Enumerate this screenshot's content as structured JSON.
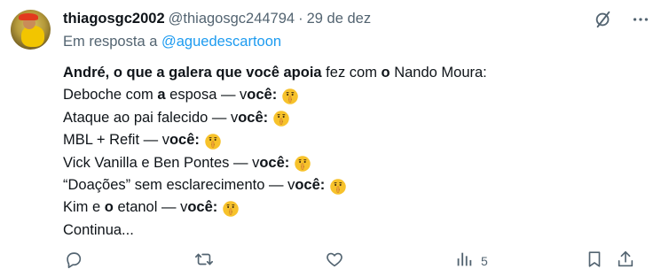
{
  "tweet": {
    "display_name": "thiagosgc2002",
    "handle": "@thiagosgc244794",
    "separator": "·",
    "date": "29 de dez",
    "reply_prefix": "Em resposta a",
    "reply_to": "@aguedescartoon",
    "lines": [
      {
        "segments": [
          {
            "text": "André, o que a galera que você apoia",
            "bold": true
          },
          {
            "text": " fez com ",
            "bold": false
          },
          {
            "text": "o",
            "bold": true
          },
          {
            "text": " Nando Moura:",
            "bold": false
          }
        ],
        "emoji": false
      },
      {
        "segments": [
          {
            "text": "Deboche com ",
            "bold": false
          },
          {
            "text": "a",
            "bold": true
          },
          {
            "text": " esposa — v",
            "bold": false
          },
          {
            "text": "ocê:",
            "bold": true
          }
        ],
        "emoji": true
      },
      {
        "segments": [
          {
            "text": "Ataque ao pai falecido — v",
            "bold": false
          },
          {
            "text": "ocê:",
            "bold": true
          }
        ],
        "emoji": true
      },
      {
        "segments": [
          {
            "text": "MBL + Refit — v",
            "bold": false
          },
          {
            "text": "ocê:",
            "bold": true
          }
        ],
        "emoji": true
      },
      {
        "segments": [
          {
            "text": "Vick Vanilla e Ben Pontes — v",
            "bold": false
          },
          {
            "text": "ocê:",
            "bold": true
          }
        ],
        "emoji": true
      },
      {
        "segments": [
          {
            "text": "“Doações” sem esclarecimento — v",
            "bold": false
          },
          {
            "text": "ocê:",
            "bold": true
          }
        ],
        "emoji": true
      },
      {
        "segments": [
          {
            "text": "Kim e ",
            "bold": false
          },
          {
            "text": "o",
            "bold": true
          },
          {
            "text": " etanol — v",
            "bold": false
          },
          {
            "text": "ocê:",
            "bold": true
          }
        ],
        "emoji": true
      },
      {
        "segments": [
          {
            "text": "Continua...",
            "bold": false
          }
        ],
        "emoji": false
      }
    ],
    "emoji_name": "shushing-face-emoji",
    "view_count": "5"
  },
  "icons": {
    "grok": "grok-slash-icon",
    "more": "more-dots-icon",
    "reply": "reply-bubble-icon",
    "retweet": "retweet-icon",
    "like": "heart-icon",
    "views": "views-bar-chart-icon",
    "bookmark": "bookmark-icon",
    "share": "share-icon"
  },
  "colors": {
    "text": "#0f1419",
    "secondary": "#536471",
    "link": "#1d9bf0"
  }
}
